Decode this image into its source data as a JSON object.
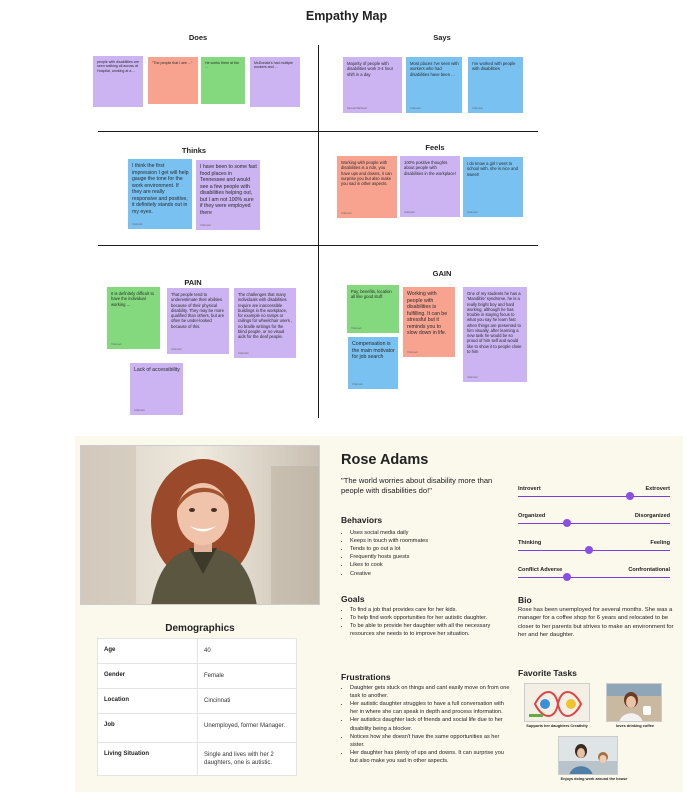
{
  "empathy_map": {
    "title": "Empathy Map",
    "sections": {
      "does": "Does",
      "says": "Says",
      "thinks": "Thinks",
      "feels": "Feels",
      "pain": "PAIN",
      "gain": "GAIN"
    },
    "does_notes": [
      {
        "text": "people with disabilities are seen walking all across at Hospital, working at a ..."
      },
      {
        "text": "\"The people that I see ...\""
      },
      {
        "text": "He works there at the ..."
      },
      {
        "text": "McDonald's had multiple workers and ..."
      }
    ],
    "says_notes": [
      {
        "text": "Majority of people with disabilities work 3-4 hour shift in a day",
        "author": "Samuel Mathews"
      },
      {
        "text": "Most places I've seen with workers who had disabilities have been ...",
        "author": "Unknown"
      },
      {
        "text": "I've worked with people with disabilities",
        "author": "Unknown"
      }
    ],
    "thinks_notes": [
      {
        "text": "I think the first impression I get will help gauge the tone for the work environment. If they are really responsive and positive, it definitely stands out in my eyes.",
        "author": "Unknown"
      },
      {
        "text": "I have been to some fast food places in Tennessee and would see a few people with disabilities helping out, but I am not 100% sure if they were employed there",
        "author": "Unknown"
      }
    ],
    "feels_notes": [
      {
        "text": "Working with people with disabilities is a ride, you have ups and downs, it can surprise you but also make you sad in other aspects.",
        "author": "Unknown"
      },
      {
        "text": "100% positive thoughts about people with disabilities in the workplace!",
        "author": "Unknown"
      },
      {
        "text": "I do know a girl I went to school with, she is nice and sweet!",
        "author": "Unknown"
      }
    ],
    "pain_notes": [
      {
        "text": "It is definitely difficult to have the individual working ...",
        "author": "Unknown"
      },
      {
        "text": "That people tend to underestimate their abilities because of their physical disability. They may be more qualified than others, but are often be under-looked because of this.",
        "author": "Unknown"
      },
      {
        "text": "The challenges that many individuals with disabilities require are inaccessible buildings in the workplace, for example no ramps or railings for wheelchair users , no braille writings for the blind people, or no visual aids for the deaf people.",
        "author": "Unknown"
      },
      {
        "text": "Lack of accessibility",
        "author": "Unknown"
      }
    ],
    "gain_notes": [
      {
        "text": "Pay, benefits, location all like good stuff.",
        "author": "Unknown"
      },
      {
        "text": "Working with people with disabilities is fulfilling. It can be stressful but it reminds you to slow down in life.",
        "author": "Unknown"
      },
      {
        "text": "One of my students he has a 'Mandible' syndrome, he is a really bright boy and hard working, although he has trouble in staying focus to what you say he learn fast when things are presented to him visually, after learning a new task he would be so proud of him self and would like to show it to people close to him",
        "author": "Unknown"
      },
      {
        "text": "Compensation is the main motivator for job search",
        "author": "Unknown"
      }
    ]
  },
  "persona": {
    "name": "Rose Adams",
    "quote": "\"The world worries about disability more than people with disabilities do!\"",
    "behaviors_title": "Behaviors",
    "behaviors": [
      "Uses social media daily",
      "Keeps in touch with roommates",
      "Tends to go out a lot",
      "Frequently hosts guests",
      "Likes to cook",
      "Creative"
    ],
    "goals_title": "Goals",
    "goals": [
      "To find a job that provides care for her kids.",
      "To help find work opportunities for her autistic daughter.",
      "To be able to provide her daughter with all the necessary resources she needs to to improve her situation."
    ],
    "frustrations_title": "Frustrations",
    "frustrations": [
      "Daughter gets stuck on things and cant easily move on from one task to  another.",
      "Her autistic daughter struggles to have a full conversation with her in where she can speak in depth and process information.",
      "Her autistics daughter lack of friends and social life due to her disability being a blocker.",
      "Notices how she doesn't have the same opportunities as her sister.",
      "Her daughter has plenty of ups and downs. It can surprise you but also make you sad in other aspects."
    ],
    "demographics_title": "Demographics",
    "demographics": [
      {
        "key": "Age",
        "value": "40"
      },
      {
        "key": "Gender",
        "value": "Female"
      },
      {
        "key": "Location",
        "value": "Cincinnati"
      },
      {
        "key": "Job",
        "value": "Unemployed, former Manager."
      },
      {
        "key": "Living Situation",
        "value": "Single and lives with her 2 daughters, one is autistic."
      }
    ],
    "traits": [
      {
        "left": "Introvert",
        "right": "Extrovert",
        "value": 0.74
      },
      {
        "left": "Organized",
        "right": "Disorganized",
        "value": 0.32
      },
      {
        "left": "Thinking",
        "right": "Feeling",
        "value": 0.47
      },
      {
        "left": "Conflict Adverse",
        "right": "Confrontational",
        "value": 0.32
      }
    ],
    "bio_title": "Bio",
    "bio": "Rose has been unemployed for several months. She was a manager for a coffee shop for 6 years and relocated to be closer to her parents but strives to make an environment for her and her daughter.",
    "favorite_tasks_title": "Favorite Tasks",
    "favorite_tasks": [
      "Supports her daughters Creativity",
      "loves drinking coffee",
      "Enjoys doing work around the house"
    ],
    "colors": {
      "accent": "#8b4fe6",
      "background": "#fbf8ec"
    }
  }
}
